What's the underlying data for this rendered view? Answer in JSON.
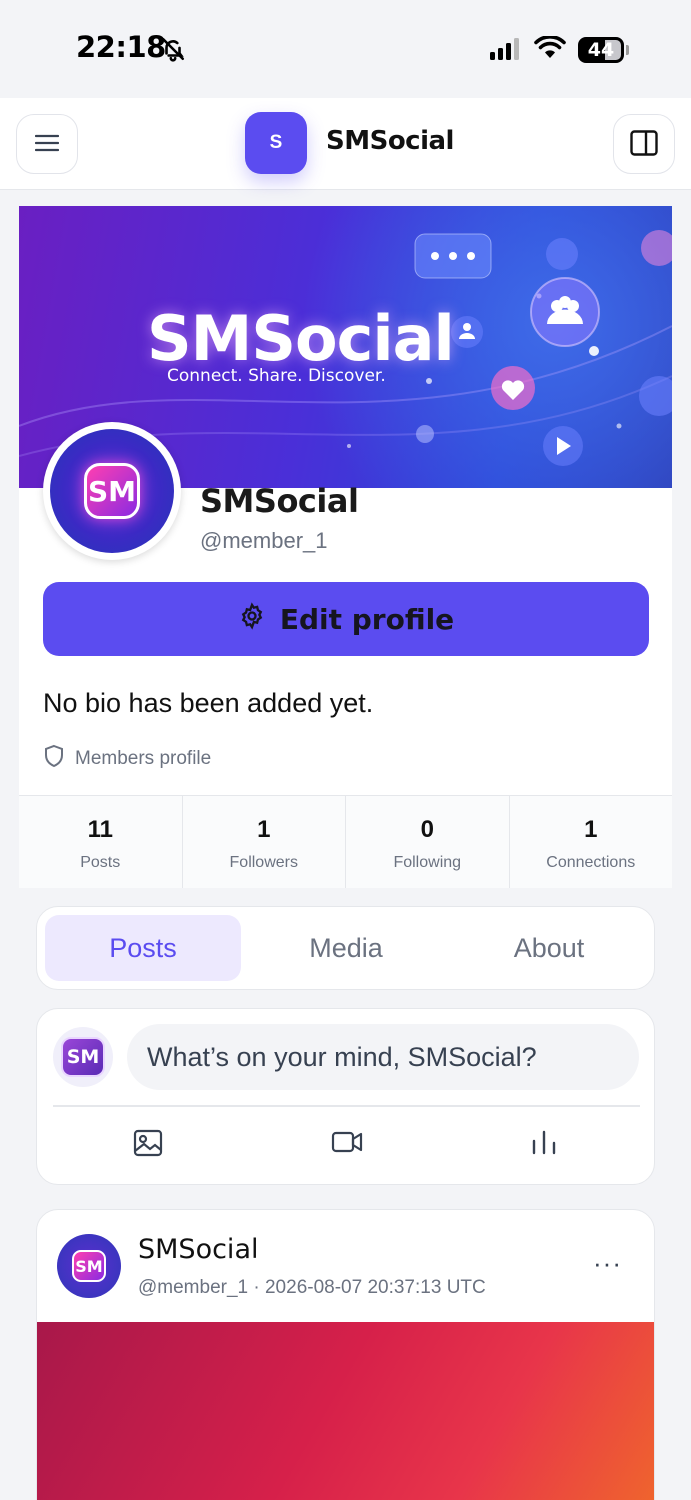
{
  "status_bar": {
    "time": "22:18",
    "battery": "44"
  },
  "header": {
    "logo_letter": "S",
    "brand": "SMSocial"
  },
  "profile": {
    "cover_title": "SMSocial",
    "cover_tagline": "Connect. Share. Discover.",
    "avatar_text": "SM",
    "name": "SMSocial",
    "handle": "@member_1",
    "edit_button": "Edit profile",
    "bio": "No bio has been added yet.",
    "profile_type": "Members profile",
    "stats": [
      {
        "value": "11",
        "label": "Posts"
      },
      {
        "value": "1",
        "label": "Followers"
      },
      {
        "value": "0",
        "label": "Following"
      },
      {
        "value": "1",
        "label": "Connections"
      }
    ]
  },
  "tabs": [
    {
      "label": "Posts",
      "active": true
    },
    {
      "label": "Media",
      "active": false
    },
    {
      "label": "About",
      "active": false
    }
  ],
  "composer": {
    "avatar_text": "SM",
    "placeholder": "What’s on your mind, SMSocial?",
    "actions": [
      "image-icon",
      "video-icon",
      "poll-icon"
    ]
  },
  "post": {
    "avatar_text": "SM",
    "author": "SMSocial",
    "meta": "@member_1 · 2026-08-07 20:37:13 UTC",
    "more": "···"
  },
  "colors": {
    "accent": "#5b4cf0",
    "tab_active_bg": "#ede9fe"
  }
}
